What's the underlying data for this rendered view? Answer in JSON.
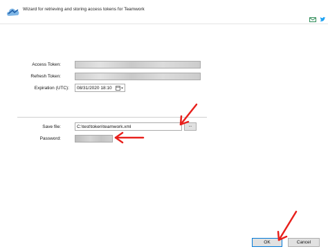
{
  "window": {
    "title": "Wizard for retrieving and storing access tokens for Teamwork",
    "icons": [
      "cloud-app-icon",
      "mail-icon",
      "twitter-icon"
    ]
  },
  "form": {
    "access_token_label": "Access Token:",
    "refresh_token_label": "Refresh Token:",
    "expiration_label": "Expiration (UTC):",
    "expiration_value": "08/31/2020 18:10",
    "save_file_label": "Save file:",
    "save_file_value": "C:\\test\\token\\teamwork.xml",
    "password_label": "Password:",
    "browse_label": "..."
  },
  "buttons": {
    "ok": "OK",
    "cancel": "Cancel"
  },
  "colors": {
    "annotation_arrow": "#e8201c",
    "ok_border": "#0078d7"
  }
}
